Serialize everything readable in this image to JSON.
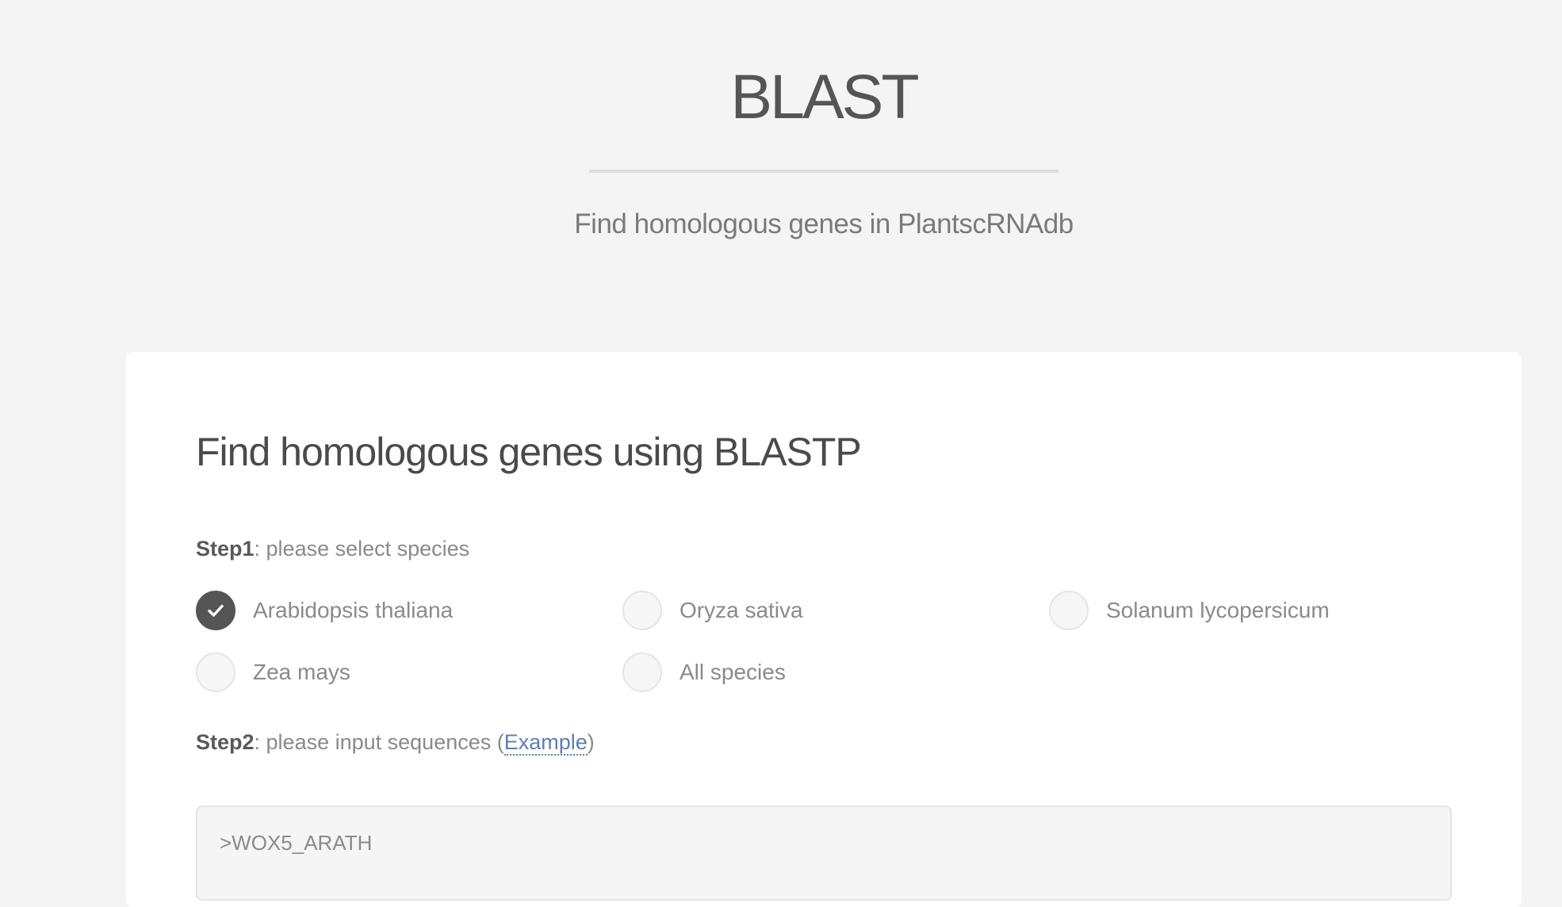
{
  "hero": {
    "title": "BLAST",
    "subtitle": "Find homologous genes in PlantscRNAdb"
  },
  "card": {
    "title": "Find homologous genes using BLASTP",
    "step1": {
      "label": "Step1",
      "text": ": please select species"
    },
    "species": [
      {
        "label": "Arabidopsis thaliana",
        "checked": true
      },
      {
        "label": "Oryza sativa",
        "checked": false
      },
      {
        "label": "Solanum lycopersicum",
        "checked": false
      },
      {
        "label": "Zea mays",
        "checked": false
      },
      {
        "label": "All species",
        "checked": false
      }
    ],
    "step2": {
      "label": "Step2",
      "text": ": please input sequences (",
      "link": "Example",
      "close": ")"
    },
    "sequence_value": ">WOX5_ARATH"
  },
  "colors": {
    "page_bg": "#f4f4f4",
    "card_bg": "#ffffff",
    "link": "#5b7fb0",
    "checked_radio": "#555555"
  }
}
